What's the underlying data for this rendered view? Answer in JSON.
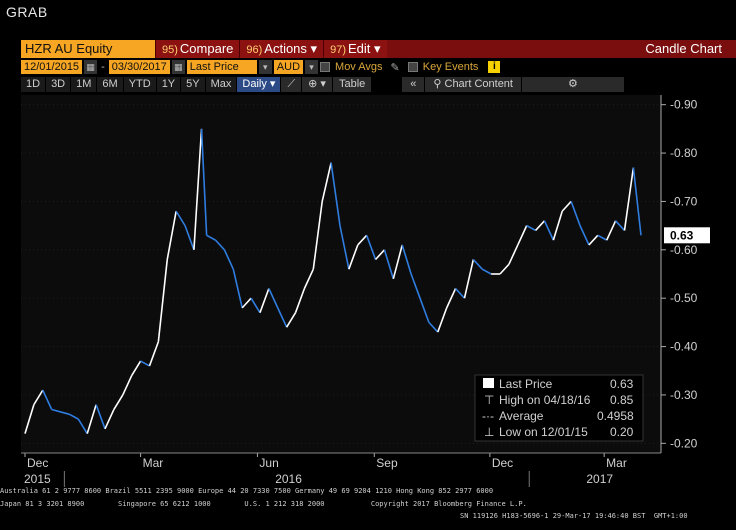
{
  "window_title": "GRAB",
  "toolbar": {
    "security": "HZR AU Equity",
    "compare_num": "95)",
    "compare_label": "Compare",
    "actions_num": "96)",
    "actions_label": "Actions",
    "edit_num": "97)",
    "edit_label": "Edit",
    "chart_type": "Candle Chart"
  },
  "controls": {
    "start_date": "12/01/2015",
    "end_date": "03/30/2017",
    "field": "Last Price",
    "currency": "AUD",
    "mov_avgs": "Mov Avgs",
    "key_events": "Key Events"
  },
  "periods": [
    "1D",
    "3D",
    "1M",
    "6M",
    "YTD",
    "1Y",
    "5Y",
    "Max"
  ],
  "frequency": "Daily",
  "table_label": "Table",
  "chart_content_label": "Chart Content",
  "colors": {
    "accent": "#f6a623",
    "header": "#8c1212",
    "rising": "#ffffff",
    "falling": "#2f7de1"
  },
  "chart_data": {
    "type": "line",
    "y_ticks": [
      "0.90",
      "0.80",
      "0.70",
      "0.60",
      "0.50",
      "0.40",
      "0.30",
      "0.20"
    ],
    "ylim": [
      0.18,
      0.92
    ],
    "x_ticks": [
      "Dec",
      "Mar",
      "Jun",
      "Sep",
      "Dec",
      "Mar"
    ],
    "x_years": [
      "2015",
      "2016",
      "2017"
    ],
    "last_value_tag": "0.63",
    "x_start": "2015-12-01",
    "x_end": "2017-03-30",
    "series": [
      {
        "x": [
          "2015-12-01",
          "2015-12-08",
          "2015-12-15",
          "2015-12-22",
          "2016-01-05",
          "2016-01-12",
          "2016-01-19",
          "2016-01-26",
          "2016-02-02",
          "2016-02-09",
          "2016-02-16",
          "2016-02-23",
          "2016-03-01",
          "2016-03-08",
          "2016-03-15",
          "2016-03-22",
          "2016-03-29",
          "2016-04-05",
          "2016-04-12",
          "2016-04-18",
          "2016-04-22",
          "2016-04-29",
          "2016-05-06",
          "2016-05-13",
          "2016-05-20",
          "2016-05-27",
          "2016-06-03",
          "2016-06-10",
          "2016-06-17",
          "2016-06-24",
          "2016-07-01",
          "2016-07-08",
          "2016-07-15",
          "2016-07-22",
          "2016-07-29",
          "2016-08-05",
          "2016-08-12",
          "2016-08-19",
          "2016-08-26",
          "2016-09-02",
          "2016-09-09",
          "2016-09-16",
          "2016-09-23",
          "2016-09-30",
          "2016-10-07",
          "2016-10-14",
          "2016-10-21",
          "2016-10-28",
          "2016-11-04",
          "2016-11-11",
          "2016-11-18",
          "2016-11-25",
          "2016-12-02",
          "2016-12-09",
          "2016-12-16",
          "2016-12-23",
          "2016-12-30",
          "2017-01-06",
          "2017-01-13",
          "2017-01-20",
          "2017-01-27",
          "2017-02-03",
          "2017-02-10",
          "2017-02-17",
          "2017-02-24",
          "2017-03-03",
          "2017-03-10",
          "2017-03-17",
          "2017-03-24",
          "2017-03-30"
        ],
        "values": [
          0.22,
          0.28,
          0.31,
          0.27,
          0.26,
          0.25,
          0.22,
          0.28,
          0.23,
          0.27,
          0.3,
          0.34,
          0.37,
          0.36,
          0.41,
          0.58,
          0.68,
          0.65,
          0.6,
          0.85,
          0.63,
          0.62,
          0.6,
          0.56,
          0.48,
          0.5,
          0.47,
          0.52,
          0.48,
          0.44,
          0.47,
          0.52,
          0.56,
          0.7,
          0.78,
          0.65,
          0.56,
          0.61,
          0.63,
          0.58,
          0.6,
          0.54,
          0.61,
          0.55,
          0.5,
          0.45,
          0.43,
          0.48,
          0.52,
          0.5,
          0.58,
          0.56,
          0.55,
          0.55,
          0.57,
          0.61,
          0.65,
          0.64,
          0.66,
          0.62,
          0.68,
          0.7,
          0.65,
          0.61,
          0.63,
          0.62,
          0.66,
          0.64,
          0.77,
          0.63
        ]
      }
    ],
    "legend": {
      "last_price_label": "Last Price",
      "last_price_value": "0.63",
      "high_label": "High on 04/18/16",
      "high_value": "0.85",
      "average_label": "Average",
      "average_value": "0.4958",
      "low_label": "Low on 12/01/15",
      "low_value": "0.20"
    }
  },
  "footer": {
    "line1": "Australia 61 2 9777 8600 Brazil 5511 2395 9000 Europe 44 20 7330 7500 Germany 49 69 9204 1210 Hong Kong 852 2977 6000",
    "line2": "Japan 81 3 3201 8900        Singapore 65 6212 1000        U.S. 1 212 318 2000           Copyright 2017 Bloomberg Finance L.P.",
    "line3": "SN 119126 H183-5696-1 29-Mar-17 19:46:40 BST  GMT+1:00"
  }
}
